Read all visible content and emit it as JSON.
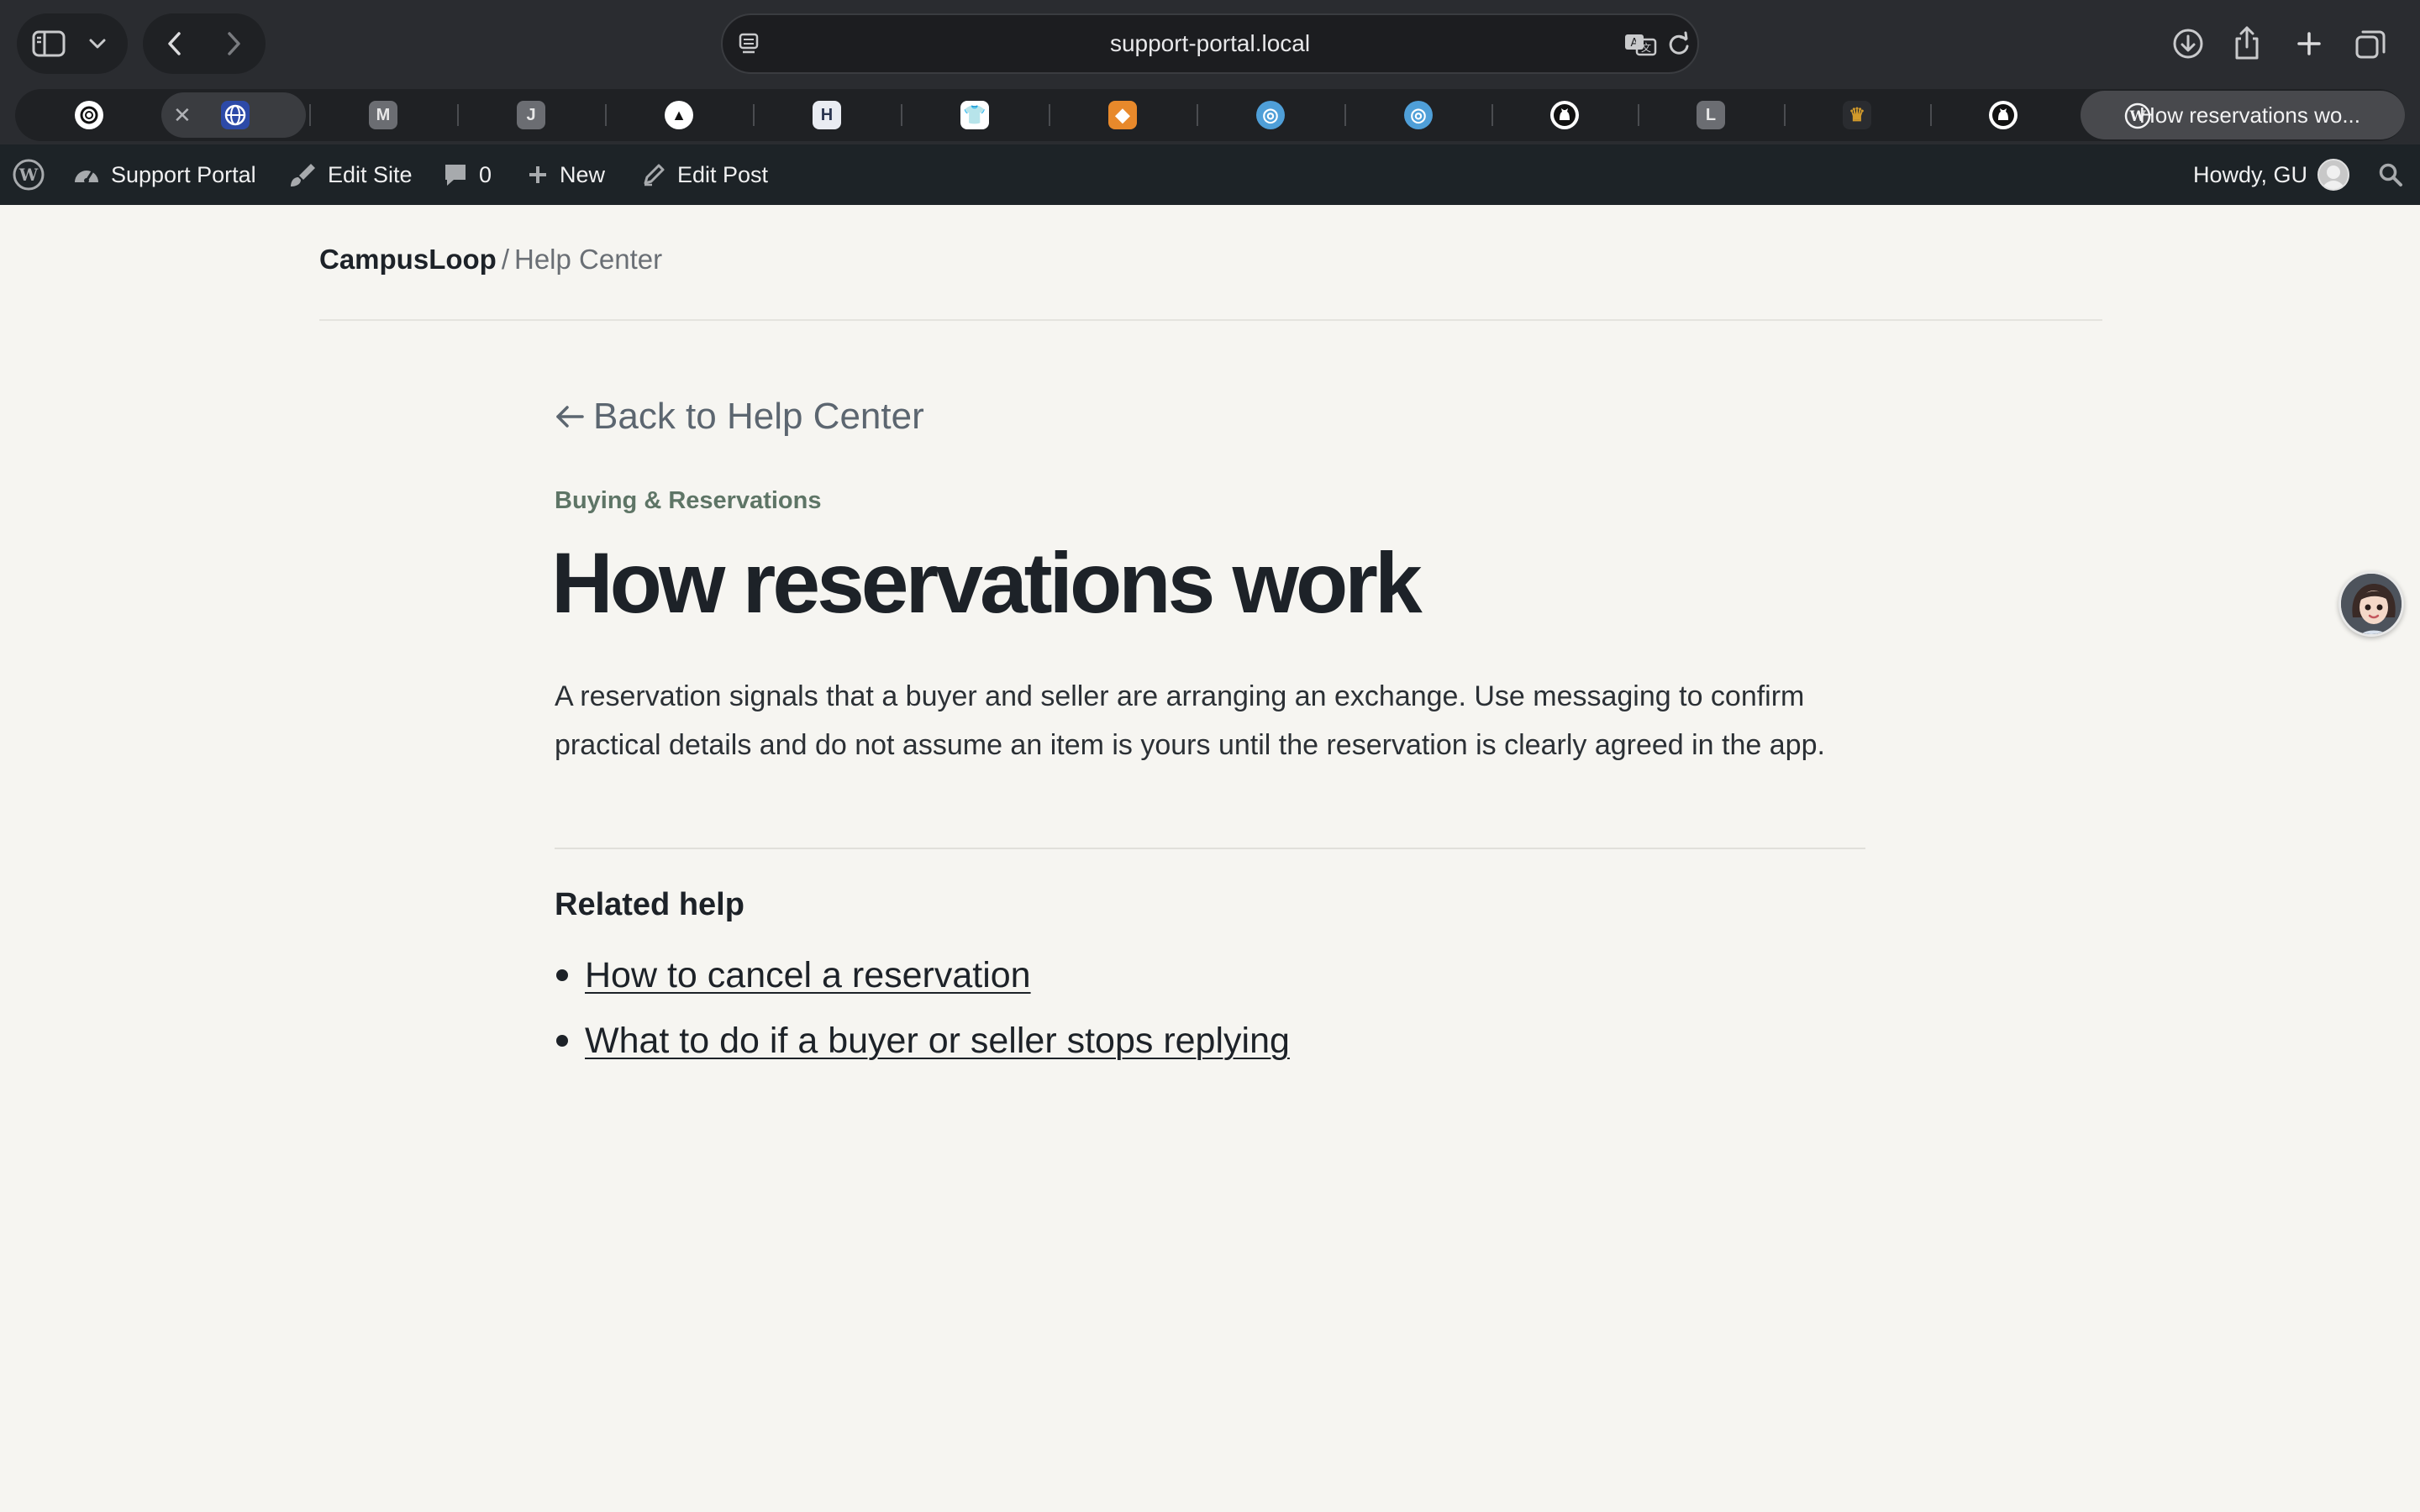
{
  "browser": {
    "url": "support-portal.local",
    "tabs": [
      {
        "icon": "openai-icon",
        "bg": "#2a2c30",
        "fg": "#ffffff",
        "glyph": ""
      },
      {
        "icon": "globe-app-icon",
        "bg": "#2d4aa8",
        "fg": "#ffffff",
        "glyph": ""
      },
      {
        "icon": "m-letter-icon",
        "bg": "#6b6d72",
        "fg": "#e8e8e8",
        "glyph": "M"
      },
      {
        "icon": "j-letter-icon",
        "bg": "#6b6d72",
        "fg": "#e8e8e8",
        "glyph": "J"
      },
      {
        "icon": "triangle-app-icon",
        "bg": "#ffffff",
        "fg": "#111111",
        "glyph": "▲"
      },
      {
        "icon": "h-app-icon",
        "bg": "#e9ecf2",
        "fg": "#2a3550",
        "glyph": "H"
      },
      {
        "icon": "shirt-app-icon",
        "bg": "#ffffff",
        "fg": "#2a6fd6",
        "glyph": "👕"
      },
      {
        "icon": "orange-app-icon",
        "bg": "#e8892b",
        "fg": "#ffffff",
        "glyph": "◆"
      },
      {
        "icon": "sphere-app-icon",
        "bg": "#4f9fd8",
        "fg": "#ffffff",
        "glyph": "◎"
      },
      {
        "icon": "sphere-app-icon-2",
        "bg": "#4f9fd8",
        "fg": "#ffffff",
        "glyph": "◎"
      },
      {
        "icon": "github-icon",
        "bg": "#ffffff",
        "fg": "#111111",
        "glyph": ""
      },
      {
        "icon": "l-letter-icon",
        "bg": "#6b6d72",
        "fg": "#e8e8e8",
        "glyph": "L"
      },
      {
        "icon": "crest-app-icon",
        "bg": "#2a2c30",
        "fg": "#d29a2b",
        "glyph": "♛"
      },
      {
        "icon": "github-icon-2",
        "bg": "#ffffff",
        "fg": "#111111",
        "glyph": ""
      }
    ],
    "active_tab_title": "How reservations wo..."
  },
  "adminbar": {
    "site_name": "Support Portal",
    "edit_site": "Edit Site",
    "comments_count": "0",
    "new_label": "New",
    "edit_post": "Edit Post",
    "howdy": "Howdy, GU"
  },
  "page": {
    "brand": "CampusLoop",
    "separator": "/",
    "section": "Help Center",
    "back_link": "Back to Help Center",
    "category": "Buying & Reservations",
    "title": "How reservations work",
    "body": "A reservation signals that a buyer and seller are arranging an exchange. Use messaging to confirm practical details and do not assume an item is yours until the reservation is clearly agreed in the app.",
    "related_heading": "Related help",
    "related_links": [
      "How to cancel a reservation",
      "What to do if a buyer or seller stops replying"
    ]
  }
}
